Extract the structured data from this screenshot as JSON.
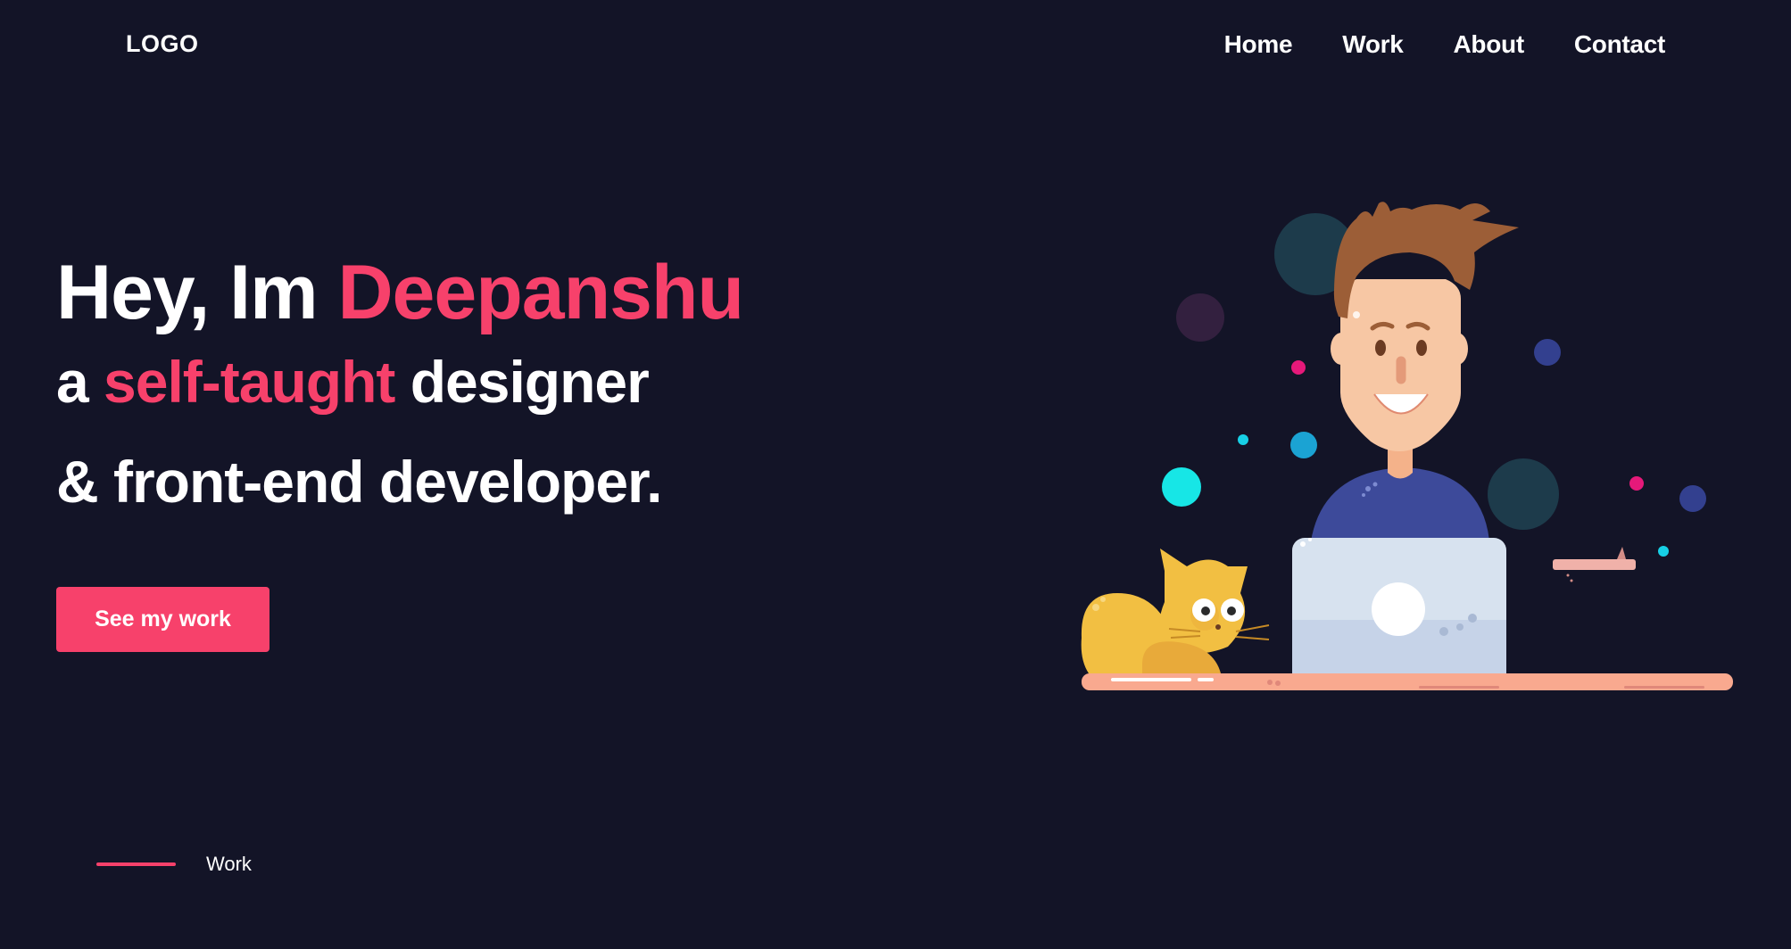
{
  "header": {
    "logo": "LOGO",
    "nav": [
      {
        "label": "Home"
      },
      {
        "label": "Work"
      },
      {
        "label": "About"
      },
      {
        "label": "Contact"
      }
    ]
  },
  "hero": {
    "line1_prefix": "Hey, Im ",
    "line1_name": "Deepanshu",
    "line2_prefix": "a ",
    "line2_accent": "self-taught",
    "line2_suffix": " designer",
    "line3": "& front-end developer.",
    "cta_label": "See my work"
  },
  "scroll_indicator": {
    "label": "Work"
  },
  "illustration": {
    "icon": "developer-with-laptop-and-cat-illustration"
  },
  "colors": {
    "background": "#131427",
    "accent": "#f7416b",
    "text": "#ffffff"
  }
}
